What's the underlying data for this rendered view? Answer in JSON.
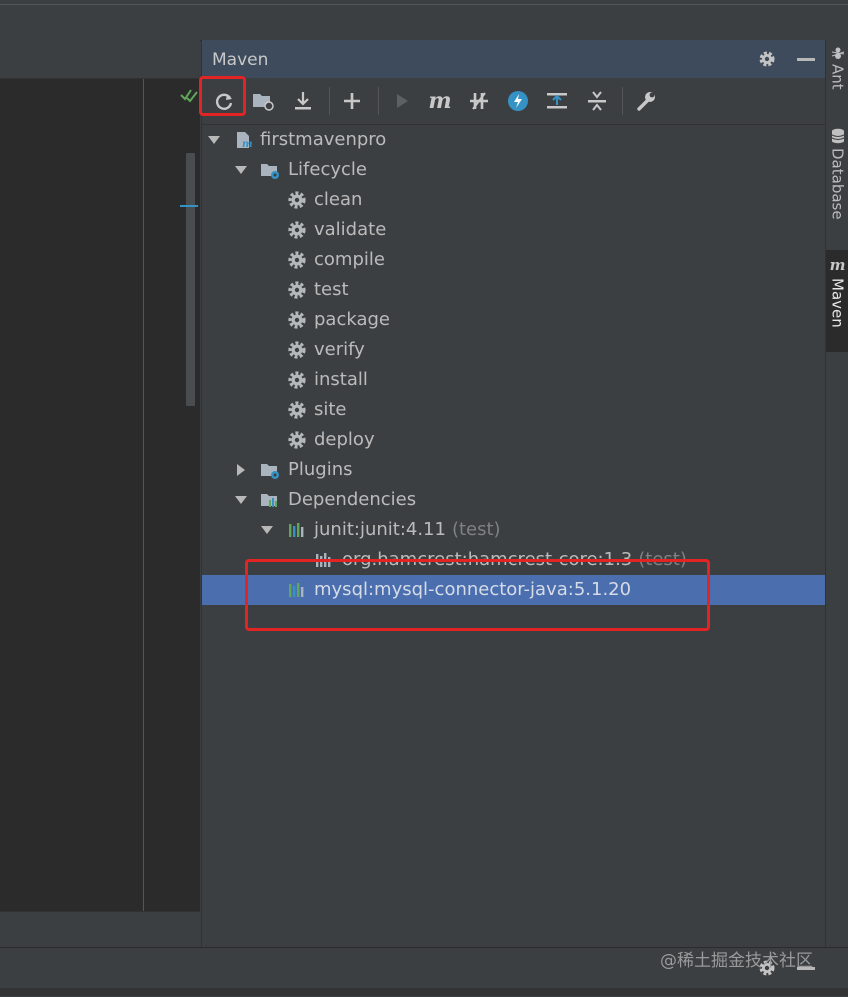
{
  "panel": {
    "title": "Maven"
  },
  "toolbar": {
    "buttons": [
      {
        "name": "reload-all-maven-projects",
        "icon": "refresh-icon"
      },
      {
        "name": "generate-sources",
        "icon": "folder-refresh-icon"
      },
      {
        "name": "download-sources",
        "icon": "download-icon"
      },
      {
        "name": "add-maven-projects",
        "icon": "plus-icon"
      },
      {
        "name": "run-maven-build",
        "icon": "run-icon"
      },
      {
        "name": "execute-maven-goal",
        "icon": "maven-m-icon"
      },
      {
        "name": "toggle-offline-mode",
        "icon": "offline-icon"
      },
      {
        "name": "skip-tests",
        "icon": "lightning-icon"
      },
      {
        "name": "show-dependencies",
        "icon": "dependencies-diagram-icon"
      },
      {
        "name": "collapse-all",
        "icon": "collapse-icon"
      },
      {
        "name": "maven-settings",
        "icon": "wrench-icon"
      }
    ]
  },
  "tree": {
    "project": "firstmavenpro",
    "lifecycle_label": "Lifecycle",
    "lifecycle": [
      "clean",
      "validate",
      "compile",
      "test",
      "package",
      "verify",
      "install",
      "site",
      "deploy"
    ],
    "plugins_label": "Plugins",
    "dependencies_label": "Dependencies",
    "dependencies": [
      {
        "name": "junit:junit:4.11",
        "scope": "(test)"
      },
      {
        "name": "org.hamcrest:hamcrest-core:1.3",
        "scope": "(test)"
      },
      {
        "name": "mysql:mysql-connector-java:5.1.20",
        "scope": ""
      }
    ]
  },
  "right_tabs": [
    "Ant",
    "Database",
    "Maven"
  ],
  "watermark": "@稀土掘金技术社区",
  "colors": {
    "background": "#3c3f41",
    "editor": "#2b2b2b",
    "header": "#3d4b5c",
    "selection": "#4b6eaf",
    "highlight": "#e32424",
    "accent_blue": "#3592c4"
  }
}
